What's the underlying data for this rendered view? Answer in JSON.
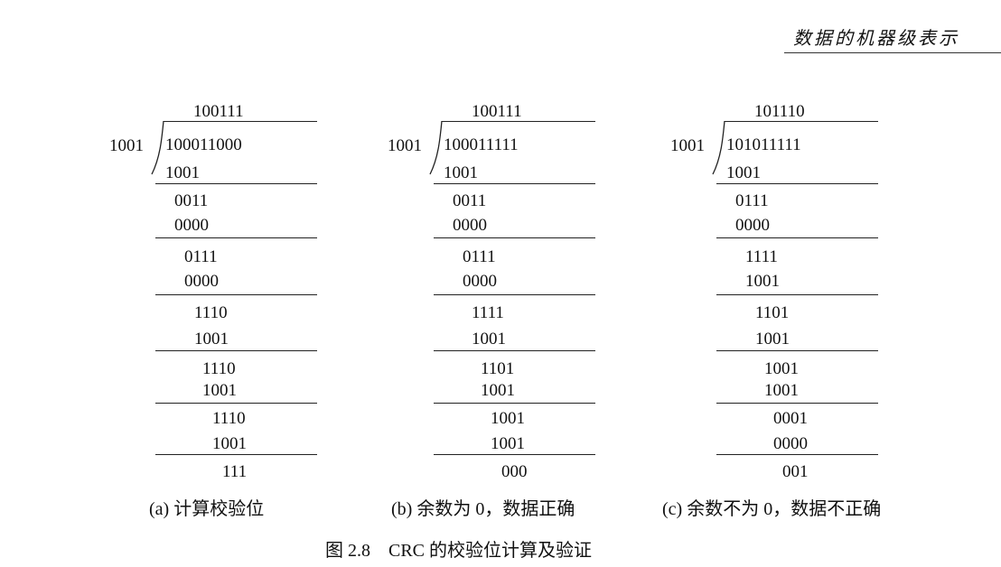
{
  "header": {
    "title": "数据的机器级表示"
  },
  "panels": [
    {
      "divisor": "1001",
      "quotient": "100111",
      "dividend": "100011000",
      "lines": [
        "1001",
        "0011",
        "0000",
        "0111",
        "0000",
        "1110",
        "1001",
        "1110",
        "1001",
        "1110",
        "1001",
        "111"
      ],
      "caption": "(a) 计算校验位"
    },
    {
      "divisor": "1001",
      "quotient": "100111",
      "dividend": "100011111",
      "lines": [
        "1001",
        "0011",
        "0000",
        "0111",
        "0000",
        "1111",
        "1001",
        "1101",
        "1001",
        "1001",
        "1001",
        "000"
      ],
      "caption": "(b) 余数为 0，数据正确"
    },
    {
      "divisor": "1001",
      "quotient": "101110",
      "dividend": "101011111",
      "lines": [
        "1001",
        "0111",
        "0000",
        "1111",
        "1001",
        "1101",
        "1001",
        "1001",
        "1001",
        "0001",
        "0000",
        "001"
      ],
      "caption": "(c) 余数不为 0，数据不正确"
    }
  ],
  "figure_caption": "图 2.8　CRC 的校验位计算及验证"
}
